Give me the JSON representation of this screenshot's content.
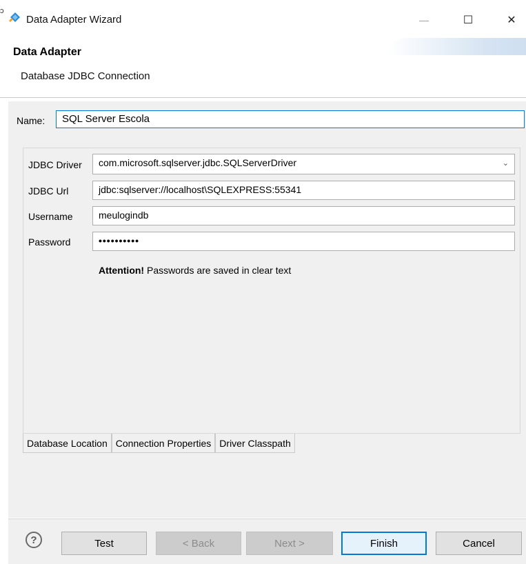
{
  "window": {
    "title": "Data Adapter Wizard",
    "edge_char": "ɔ",
    "controls": {
      "minimize": "—",
      "maximize": "☐",
      "close": "✕"
    }
  },
  "header": {
    "title": "Data Adapter",
    "subtitle": "Database JDBC Connection"
  },
  "name": {
    "label": "Name:",
    "value": "SQL Server Escola"
  },
  "connection": {
    "driver_label": "JDBC Driver",
    "driver_value": "com.microsoft.sqlserver.jdbc.SQLServerDriver",
    "url_label": "JDBC Url",
    "url_value": "jdbc:sqlserver://localhost\\SQLEXPRESS:55341",
    "username_label": "Username",
    "username_value": "meulogindb",
    "password_label": "Password",
    "password_value": "••••••••••",
    "attention_bold": "Attention!",
    "attention_text": " Passwords are saved in clear text"
  },
  "tabs": [
    "Database Location",
    "Connection Properties",
    "Driver Classpath"
  ],
  "footer": {
    "help": "?",
    "test": "Test",
    "back": "< Back",
    "next": "Next >",
    "finish": "Finish",
    "cancel": "Cancel"
  },
  "colors": {
    "accent": "#0078d7",
    "panel_bg": "#f0f0f0"
  },
  "icons": {
    "app": "data-adapter-icon",
    "dropdown": "chevron-down-icon",
    "help": "help-icon"
  }
}
